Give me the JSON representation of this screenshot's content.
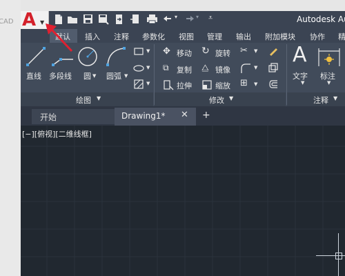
{
  "background_text": "CAD",
  "app": {
    "title": "Autodesk Au",
    "logo_letter": "A"
  },
  "quick_access": {
    "icons": [
      "new-icon",
      "open-icon",
      "save-icon",
      "save-as-icon",
      "share-icon",
      "print-icon",
      "undo-icon",
      "redo-icon",
      "dropdown-icon"
    ]
  },
  "menu": {
    "items": [
      "默认",
      "插入",
      "注释",
      "参数化",
      "视图",
      "管理",
      "输出",
      "附加模块",
      "协作",
      "精"
    ]
  },
  "ribbon": {
    "draw": {
      "line": "直线",
      "polyline": "多段线",
      "circle": "圆",
      "arc": "圆弧",
      "footer": "绘图"
    },
    "modify": {
      "move": "移动",
      "rotate": "旋转",
      "copy": "复制",
      "mirror": "镜像",
      "stretch": "拉伸",
      "scale": "缩放",
      "footer": "修改"
    },
    "annotation": {
      "text": "文字",
      "dimension": "标注",
      "footer": "注释"
    }
  },
  "tabs": {
    "start": "开始",
    "drawing": "Drawing1*",
    "close": "✕",
    "add": "+"
  },
  "viewport": {
    "label": "[−][俯视][二维线框]"
  },
  "colors": {
    "accent_red": "#d3212b",
    "canvas": "#212830",
    "ribbon": "#414b5a"
  }
}
